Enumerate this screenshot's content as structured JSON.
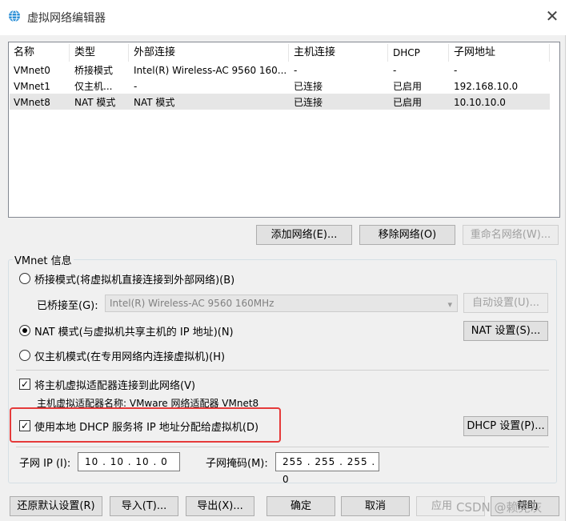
{
  "window": {
    "title": "虚拟网络编辑器",
    "close_glyph": "✕"
  },
  "table": {
    "headers": [
      "名称",
      "类型",
      "外部连接",
      "主机连接",
      "DHCP",
      "子网地址"
    ],
    "rows": [
      [
        "VMnet0",
        "桥接模式",
        "Intel(R) Wireless-AC 9560 160...",
        "-",
        "-",
        "-"
      ],
      [
        "VMnet1",
        "仅主机...",
        "-",
        "已连接",
        "已启用",
        "192.168.10.0"
      ],
      [
        "VMnet8",
        "NAT 模式",
        "NAT 模式",
        "已连接",
        "已启用",
        "10.10.10.0"
      ]
    ],
    "selected_row": 2
  },
  "list_buttons": {
    "add": "添加网络(E)...",
    "remove": "移除网络(O)",
    "rename": "重命名网络(W)..."
  },
  "vmnet_info": {
    "group_label": "VMnet 信息",
    "bridge_mode": "桥接模式(将虚拟机直接连接到外部网络)(B)",
    "bridged_to_label": "已桥接至(G):",
    "bridged_to_value": "Intel(R) Wireless-AC 9560 160MHz",
    "auto_settings": "自动设置(U)...",
    "nat_mode": "NAT 模式(与虚拟机共享主机的 IP 地址)(N)",
    "nat_settings": "NAT 设置(S)...",
    "host_only": "仅主机模式(在专用网络内连接虚拟机)(H)",
    "connect_adapter": "将主机虚拟适配器连接到此网络(V)",
    "adapter_name": "主机虚拟适配器名称: VMware 网络适配器 VMnet8",
    "use_dhcp": "使用本地 DHCP 服务将 IP 地址分配给虚拟机(D)",
    "dhcp_settings": "DHCP 设置(P)...",
    "subnet_ip_label": "子网 IP (I):",
    "subnet_ip_value": "10 . 10 . 10 . 0",
    "subnet_mask_label": "子网掩码(M):",
    "subnet_mask_value": "255 . 255 . 255 . 0"
  },
  "footer": {
    "restore": "还原默认设置(R)",
    "import": "导入(T)...",
    "export": "导出(X)...",
    "ok": "确定",
    "cancel": "取消",
    "apply": "应用",
    "help": "帮助"
  },
  "watermark": "CSDN @赖晃灰",
  "colors": {
    "highlight_border": "#e53a3a",
    "selected_row": "#e6e6e6",
    "button_face": "#e1e1e1"
  }
}
